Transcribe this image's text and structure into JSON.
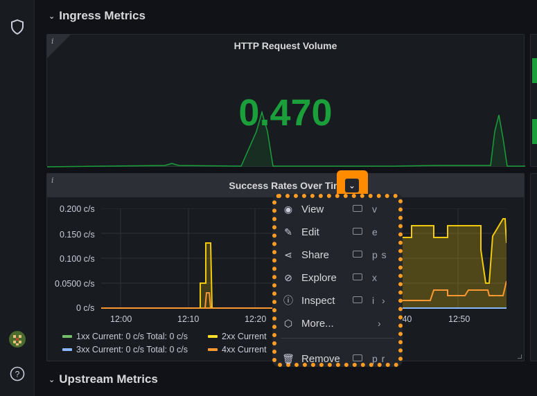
{
  "rows": {
    "ingress": "Ingress Metrics",
    "upstream": "Upstream Metrics"
  },
  "stat_panel": {
    "title": "HTTP Request Volume",
    "value": "0.470",
    "value_color": "#1a9f3b"
  },
  "graph_panel": {
    "title": "Success Rates Over Tim",
    "y_ticks": [
      "0.200 c/s",
      "0.150 c/s",
      "0.100 c/s",
      "0.0500 c/s",
      "0 c/s"
    ],
    "x_ticks": [
      "12:00",
      "12:10",
      "12:20",
      ":40",
      "12:50"
    ],
    "legend": [
      {
        "name": "1xx",
        "text": "1xx  Current: 0 c/s  Total: 0 c/s",
        "color": "#73bf69"
      },
      {
        "name": "2xx",
        "text": "2xx  Current",
        "color": "#fade2a"
      },
      {
        "name": "3xx",
        "text": "3xx  Current: 0 c/s  Total: 0 c/s",
        "color": "#8ab8ff"
      },
      {
        "name": "4xx",
        "text": "4xx  Current",
        "color": "#ff9830"
      }
    ]
  },
  "chart_data": {
    "type": "line",
    "title": "Success Rates Over Tim",
    "ylim": [
      0,
      0.2
    ],
    "y_unit": "c/s",
    "series": [
      {
        "name": "2xx",
        "color": "#f2cc0c",
        "x": [
          "12:11",
          "12:12",
          "12:12.5",
          "12:13"
        ],
        "values": [
          0.05,
          0.05,
          0.135,
          0.0
        ]
      },
      {
        "name": "4xx",
        "color": "#ff9830",
        "x": [
          "12:11.5",
          "12:12.5"
        ],
        "values": [
          0.0,
          0.03
        ]
      }
    ]
  },
  "context_menu": {
    "items": [
      {
        "icon": "eye-icon",
        "glyph": "◉",
        "label": "View",
        "shortcut": "v",
        "has_kbd": true
      },
      {
        "icon": "edit-icon",
        "glyph": "✎",
        "label": "Edit",
        "shortcut": "e",
        "has_kbd": true
      },
      {
        "icon": "share-icon",
        "glyph": "⋖",
        "label": "Share",
        "shortcut": "p s",
        "has_kbd": true
      },
      {
        "icon": "compass-icon",
        "glyph": "⊘",
        "label": "Explore",
        "shortcut": "x",
        "has_kbd": true
      },
      {
        "icon": "info-circle-icon",
        "glyph": "ⓘ",
        "label": "Inspect",
        "shortcut": "i",
        "has_kbd": true,
        "submenu": true
      },
      {
        "icon": "cube-icon",
        "glyph": "⬡",
        "label": "More...",
        "shortcut": "",
        "has_kbd": false,
        "submenu": true
      },
      {
        "icon": "trash-icon",
        "glyph": "🗑",
        "label": "Remove",
        "shortcut": "p r",
        "has_kbd": true
      }
    ]
  },
  "colors": {
    "accent": "#ff8c00",
    "panel_bg": "#181b1f",
    "page_bg": "#111217"
  }
}
